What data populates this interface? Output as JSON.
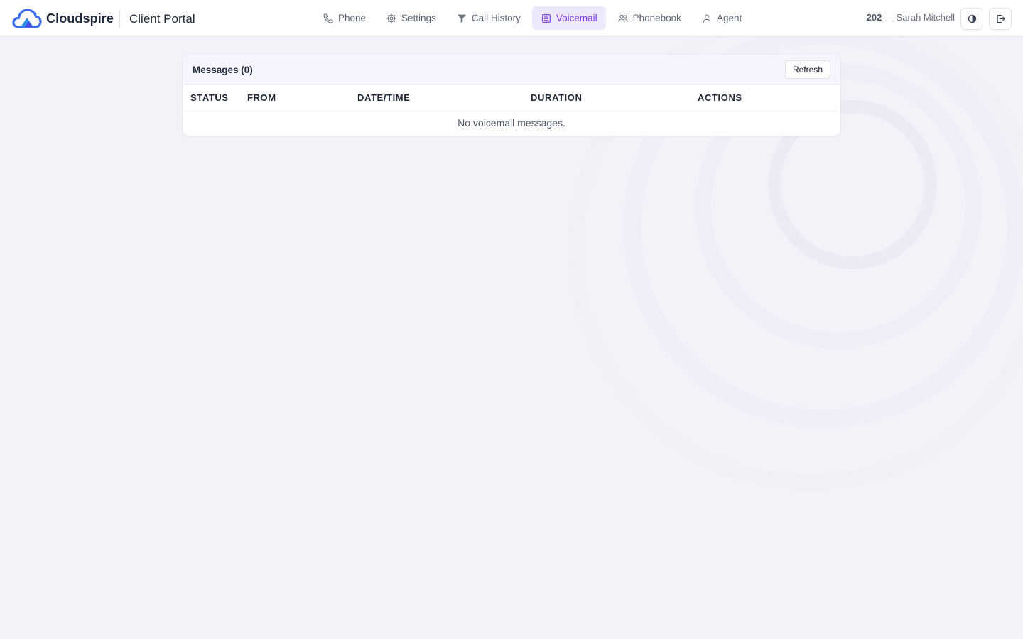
{
  "brand": {
    "name": "Cloudspire",
    "portal_title": "Client Portal"
  },
  "nav": {
    "items": [
      {
        "label": "Phone",
        "icon": "phone-icon",
        "active": false
      },
      {
        "label": "Settings",
        "icon": "gear-icon",
        "active": false
      },
      {
        "label": "Call History",
        "icon": "filter-icon",
        "active": false
      },
      {
        "label": "Voicemail",
        "icon": "voicemail-list-icon",
        "active": true
      },
      {
        "label": "Phonebook",
        "icon": "users-icon",
        "active": false
      },
      {
        "label": "Agent",
        "icon": "user-icon",
        "active": false
      }
    ]
  },
  "user": {
    "extension": "202",
    "separator": "—",
    "name": "Sarah Mitchell"
  },
  "header_actions": {
    "theme_icon": "contrast-icon",
    "logout_icon": "logout-icon"
  },
  "colors": {
    "accent": "#7c3aed",
    "accent_bg": "#ede8fb",
    "logo_blue": "#3b6df2"
  },
  "messages": {
    "title": "Messages (0)",
    "refresh_label": "Refresh",
    "columns": [
      "STATUS",
      "FROM",
      "DATE/TIME",
      "DURATION",
      "ACTIONS"
    ],
    "empty_text": "No voicemail messages."
  }
}
